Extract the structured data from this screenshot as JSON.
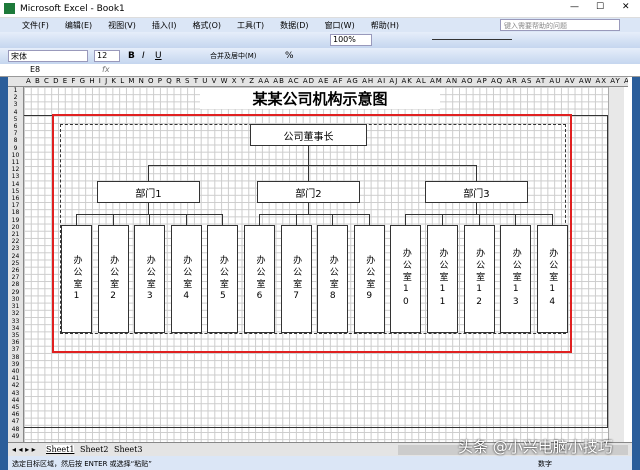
{
  "window": {
    "title": "Microsoft Excel - Book1"
  },
  "menu": [
    "文件(F)",
    "编辑(E)",
    "视图(V)",
    "插入(I)",
    "格式(O)",
    "工具(T)",
    "数据(D)",
    "窗口(W)",
    "帮助(H)"
  ],
  "help_placeholder": "键入需要帮助的问题",
  "toolbar": {
    "zoom": "100%",
    "font": "宋体",
    "size": "12",
    "bold": "B",
    "italic": "I",
    "underline": "U",
    "merge": "合并及居中(M)",
    "percent": "%"
  },
  "formula": {
    "cell_ref": "E8",
    "fx": "fx",
    "value": ""
  },
  "columns": "A B C D E F G H I J K L M N O P Q R S T U V W X Y Z AA AB AC AD AE AF AG AH AI AJ AK AL AM AN AO AP AQ AR AS AT AU AV AW AX AY AZ BA BB BC BD BE BF BG BH BI BJ BK BL BM BN BO BP BQ BR BS BT BU BV BW BX BY BZ CA CB CC",
  "chart": {
    "title": "某某公司机构示意图",
    "root": "公司董事长",
    "departments": [
      {
        "name": "部门1",
        "offices": [
          "办公室1",
          "办公室2",
          "办公室3",
          "办公室4",
          "办公室5"
        ]
      },
      {
        "name": "部门2",
        "offices": [
          "办公室6",
          "办公室7",
          "办公室8",
          "办公室9"
        ]
      },
      {
        "name": "部门3",
        "offices": [
          "办公室10",
          "办公室11",
          "办公室12",
          "办公室13",
          "办公室14"
        ]
      }
    ]
  },
  "sheet_tabs": [
    "Sheet1",
    "Sheet2",
    "Sheet3"
  ],
  "status": {
    "message": "选定目标区域，然后按 ENTER 或选择“粘贴”",
    "mode": "数字"
  },
  "watermark": "头条 @小兴电脑小技巧"
}
